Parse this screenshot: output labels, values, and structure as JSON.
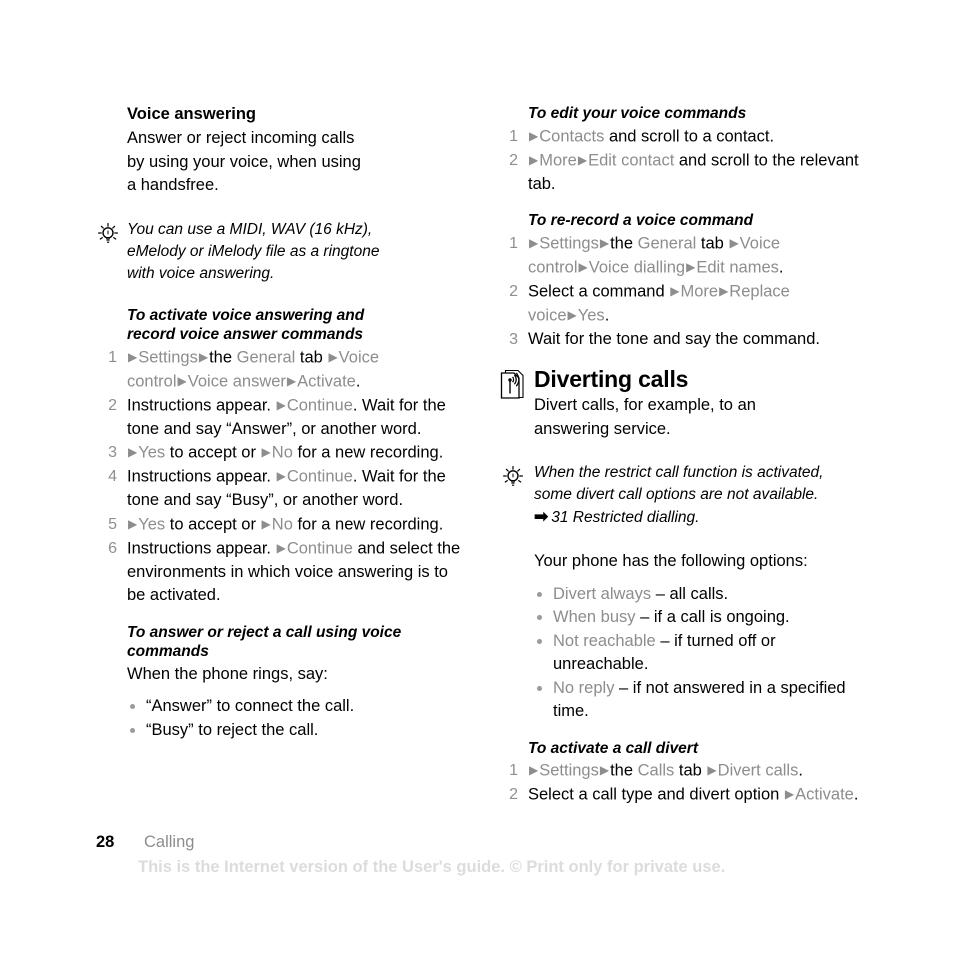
{
  "page": {
    "number": "28",
    "section": "Calling",
    "watermark": "This is the Internet version of the User's guide. © Print only for private use.",
    "tri": "▶",
    "ref_arrow": "➡"
  },
  "colors": {
    "ui_term": "#8d8d8d",
    "step_number": "#8f8f8f",
    "bullet": "#9a9a9a",
    "watermark": "#dcdcdc",
    "body_text": "#000000"
  },
  "left_column": {
    "voice_answering": {
      "heading": "Voice answering",
      "body_line1": "Answer or reject incoming calls",
      "body_line2": "by using your voice, when using",
      "body_line3": "a handsfree."
    },
    "tip": {
      "icon": "lightbulb-icon",
      "line1": "You can use a MIDI, WAV (16 kHz),",
      "line2": "eMelody or iMelody file as a ringtone",
      "line3": "with voice answering."
    },
    "proc_activate": {
      "heading_line1": "To activate voice answering and",
      "heading_line2": "record voice answer commands",
      "steps": [
        {
          "num": "1",
          "parts": [
            {
              "t": "tri"
            },
            {
              "t": "ui",
              "v": "Settings"
            },
            {
              "t": "tri"
            },
            {
              "t": "plain",
              "v": "the "
            },
            {
              "t": "ui",
              "v": "General"
            },
            {
              "t": "plain",
              "v": " tab "
            },
            {
              "t": "tri"
            },
            {
              "t": "ui",
              "v": "Voice control"
            },
            {
              "t": "tri"
            },
            {
              "t": "ui",
              "v": "Voice answer"
            },
            {
              "t": "tri"
            },
            {
              "t": "ui",
              "v": "Activate"
            },
            {
              "t": "plain",
              "v": "."
            }
          ]
        },
        {
          "num": "2",
          "parts": [
            {
              "t": "plain",
              "v": "Instructions appear. "
            },
            {
              "t": "tri"
            },
            {
              "t": "ui",
              "v": "Continue"
            },
            {
              "t": "plain",
              "v": ". Wait for the tone and say “Answer”, or another word."
            }
          ]
        },
        {
          "num": "3",
          "parts": [
            {
              "t": "tri"
            },
            {
              "t": "ui",
              "v": "Yes"
            },
            {
              "t": "plain",
              "v": " to accept or "
            },
            {
              "t": "tri"
            },
            {
              "t": "ui",
              "v": "No"
            },
            {
              "t": "plain",
              "v": " for a new recording."
            }
          ]
        },
        {
          "num": "4",
          "parts": [
            {
              "t": "plain",
              "v": "Instructions appear. "
            },
            {
              "t": "tri"
            },
            {
              "t": "ui",
              "v": "Continue"
            },
            {
              "t": "plain",
              "v": ". Wait for the tone and say “Busy”, or another word."
            }
          ]
        },
        {
          "num": "5",
          "parts": [
            {
              "t": "tri"
            },
            {
              "t": "ui",
              "v": "Yes"
            },
            {
              "t": "plain",
              "v": " to accept or "
            },
            {
              "t": "tri"
            },
            {
              "t": "ui",
              "v": "No"
            },
            {
              "t": "plain",
              "v": " for a new recording."
            }
          ]
        },
        {
          "num": "6",
          "parts": [
            {
              "t": "plain",
              "v": "Instructions appear. "
            },
            {
              "t": "tri"
            },
            {
              "t": "ui",
              "v": "Continue"
            },
            {
              "t": "plain",
              "v": " and select the environments in which voice answering is to be activated."
            }
          ]
        }
      ]
    },
    "proc_answer_reject": {
      "heading_line1": "To answer or reject a call using voice",
      "heading_line2": "commands",
      "intro": "When the phone rings, say:",
      "bullets": [
        "“Answer” to connect the call.",
        "“Busy” to reject the call."
      ]
    }
  },
  "right_column": {
    "proc_edit": {
      "heading": "To edit your voice commands",
      "steps": [
        {
          "num": "1",
          "parts": [
            {
              "t": "tri"
            },
            {
              "t": "ui",
              "v": "Contacts"
            },
            {
              "t": "plain",
              "v": " and scroll to a contact."
            }
          ]
        },
        {
          "num": "2",
          "parts": [
            {
              "t": "tri"
            },
            {
              "t": "ui",
              "v": "More"
            },
            {
              "t": "tri"
            },
            {
              "t": "ui",
              "v": "Edit contact"
            },
            {
              "t": "plain",
              "v": " and scroll to the relevant tab."
            }
          ]
        }
      ]
    },
    "proc_rerecord": {
      "heading": "To re-record a voice command",
      "steps": [
        {
          "num": "1",
          "parts": [
            {
              "t": "tri"
            },
            {
              "t": "ui",
              "v": "Settings"
            },
            {
              "t": "tri"
            },
            {
              "t": "plain",
              "v": "the "
            },
            {
              "t": "ui",
              "v": "General"
            },
            {
              "t": "plain",
              "v": " tab "
            },
            {
              "t": "tri"
            },
            {
              "t": "ui",
              "v": "Voice control"
            },
            {
              "t": "tri"
            },
            {
              "t": "ui",
              "v": "Voice dialling"
            },
            {
              "t": "tri"
            },
            {
              "t": "ui",
              "v": "Edit names"
            },
            {
              "t": "plain",
              "v": "."
            }
          ]
        },
        {
          "num": "2",
          "parts": [
            {
              "t": "plain",
              "v": "Select a command "
            },
            {
              "t": "tri"
            },
            {
              "t": "ui",
              "v": "More"
            },
            {
              "t": "tri"
            },
            {
              "t": "ui",
              "v": "Replace voice"
            },
            {
              "t": "tri"
            },
            {
              "t": "ui",
              "v": "Yes"
            },
            {
              "t": "plain",
              "v": "."
            }
          ]
        },
        {
          "num": "3",
          "parts": [
            {
              "t": "plain",
              "v": "Wait for the tone and say the command."
            }
          ]
        }
      ]
    },
    "diverting_calls": {
      "icon": "divert-calls-icon",
      "heading": "Diverting calls",
      "body_line1": "Divert calls, for example, to an",
      "body_line2": "answering service."
    },
    "tip": {
      "icon": "lightbulb-icon",
      "line1": "When the restrict call function is activated,",
      "line2": "some divert call options are not available.",
      "reference": "31 Restricted dialling."
    },
    "options_intro": "Your phone has the following options:",
    "options": [
      {
        "term": "Divert always",
        "desc": " – all calls."
      },
      {
        "term": "When busy",
        "desc": " – if a call is ongoing."
      },
      {
        "term": "Not reachable",
        "desc": " – if turned off or unreachable."
      },
      {
        "term": "No reply",
        "desc": " – if not answered in a specified time."
      }
    ],
    "proc_activate_divert": {
      "heading": "To activate a call divert",
      "steps": [
        {
          "num": "1",
          "parts": [
            {
              "t": "tri"
            },
            {
              "t": "ui",
              "v": "Settings"
            },
            {
              "t": "tri"
            },
            {
              "t": "plain",
              "v": "the "
            },
            {
              "t": "ui",
              "v": "Calls"
            },
            {
              "t": "plain",
              "v": " tab "
            },
            {
              "t": "tri"
            },
            {
              "t": "ui",
              "v": "Divert calls"
            },
            {
              "t": "plain",
              "v": "."
            }
          ]
        },
        {
          "num": "2",
          "parts": [
            {
              "t": "plain",
              "v": "Select a call type and divert option "
            },
            {
              "t": "tri"
            },
            {
              "t": "ui",
              "v": "Activate"
            },
            {
              "t": "plain",
              "v": "."
            }
          ]
        }
      ]
    }
  }
}
